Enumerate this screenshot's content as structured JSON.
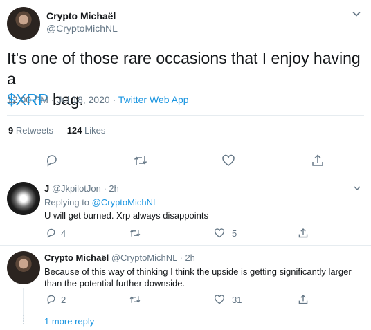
{
  "main_tweet": {
    "author_name": "Crypto Michaël",
    "author_handle": "@CryptoMichNL",
    "text_prefix": "It's one of those rare occasions that I enjoy having a",
    "cashtag": "$XRP",
    "text_suffix": " bag.",
    "timestamp": "12:00 PM · Jul 18, 2020 · ",
    "source": "Twitter Web App",
    "retweets_count": "9",
    "retweets_label": "Retweets",
    "likes_count": "124",
    "likes_label": "Likes"
  },
  "reply1": {
    "author_name": "J",
    "author_handle": "@JkpilotJon",
    "time": " · 2h",
    "replying_prefix": "Replying to ",
    "replying_handle": "@CryptoMichNL",
    "text": "U will get burned. Xrp always disappoints",
    "reply_count": "4",
    "like_count": "5"
  },
  "reply2": {
    "author_name": "Crypto Michaël",
    "author_handle": "@CryptoMichNL",
    "time": " · 2h",
    "text": "Because of this way of thinking I think the upside is getting significantly larger than the potential further downside.",
    "reply_count": "2",
    "like_count": "31"
  },
  "more_reply": "1 more reply",
  "colors": {
    "accent": "#1b95e0",
    "muted": "#657786",
    "border": "#e6ecf0"
  }
}
